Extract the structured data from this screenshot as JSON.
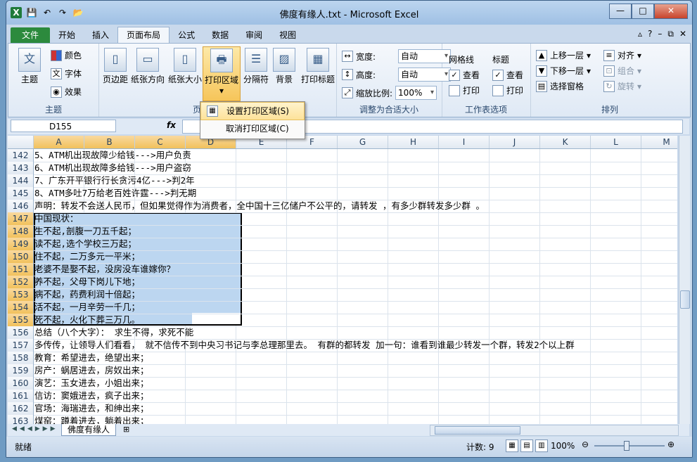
{
  "window": {
    "title": "佛度有缘人.txt - Microsoft Excel",
    "controls": {
      "minimize": "—",
      "maximize": "□",
      "close": "✕"
    }
  },
  "qat": {
    "app_icon": "X",
    "save": "💾",
    "undo": "↶",
    "redo": "↷",
    "open": "📂"
  },
  "tabs": [
    {
      "label": "文件"
    },
    {
      "label": "开始"
    },
    {
      "label": "插入"
    },
    {
      "label": "页面布局"
    },
    {
      "label": "公式"
    },
    {
      "label": "数据"
    },
    {
      "label": "审阅"
    },
    {
      "label": "视图"
    }
  ],
  "ribbon": {
    "themes": {
      "big_label": "主题",
      "colors": "颜色",
      "fonts": "字体",
      "effects": "效果",
      "group": "主题"
    },
    "page_setup": {
      "margins": "页边距",
      "orientation": "纸张方向",
      "size": "纸张大小",
      "print_area": "打印区域",
      "breaks": "分隔符",
      "background": "背景",
      "print_titles": "打印标题",
      "group": "页"
    },
    "scale": {
      "width_label": "宽度:",
      "width_value": "自动",
      "height_label": "高度:",
      "height_value": "自动",
      "scale_label": "缩放比例:",
      "scale_value": "100%",
      "group": "调整为合适大小"
    },
    "sheet_options": {
      "gridlines": "网格线",
      "headings": "标题",
      "view": "查看",
      "print": "打印",
      "group": "工作表选项"
    },
    "arrange": {
      "bring_forward": "上移一层",
      "send_backward": "下移一层",
      "selection_pane": "选择窗格",
      "align": "对齐",
      "group_btn": "组合",
      "rotate": "旋转",
      "group": "排列"
    }
  },
  "print_area_menu": [
    {
      "label": "设置打印区域(S)"
    },
    {
      "label": "取消打印区域(C)"
    }
  ],
  "formula_bar": {
    "name_box": "D155",
    "fx": "fx",
    "formula": ""
  },
  "columns": [
    "A",
    "B",
    "C",
    "D",
    "E",
    "F",
    "G",
    "H",
    "I",
    "J",
    "K",
    "L",
    "M"
  ],
  "rows": [
    {
      "n": "142",
      "text": "5、ATM机出现故障少给钱--->用户负责"
    },
    {
      "n": "143",
      "text": "6、ATM机出现故障多给钱--->用户盗窃"
    },
    {
      "n": "144",
      "text": "7、广东开平银行行长贪污4亿--->判2年"
    },
    {
      "n": "145",
      "text": "8、ATM多吐7万给老百姓许霆--->判无期"
    },
    {
      "n": "146",
      "text": "声明：转发不会送人民币，但如果觉得作为消费者，全中国十三亿储户不公平的，请转发 ，有多少群转发多少群 。"
    },
    {
      "n": "147",
      "text": "中国现状："
    },
    {
      "n": "148",
      "text": "生不起,剖腹一刀五千起；"
    },
    {
      "n": "149",
      "text": "读不起,选个学校三万起；"
    },
    {
      "n": "150",
      "text": "住不起，二万多元一平米；"
    },
    {
      "n": "151",
      "text": "老婆不是娶不起，没房没车谁嫁你？"
    },
    {
      "n": "152",
      "text": "养不起，父母下岗儿下地；"
    },
    {
      "n": "153",
      "text": "病不起，药费利润十倍起；"
    },
    {
      "n": "154",
      "text": "活不起，一月辛劳一千几；"
    },
    {
      "n": "155",
      "text": "死不起，火化下葬三万几。"
    },
    {
      "n": "156",
      "text": "总结（八个大字）： 求生不得，求死不能"
    },
    {
      "n": "157",
      "text": "多传传，让领导人们看看， 就不信传不到中央习书记与李总理那里去。 有群的都转发 加一句：谁看到谁最少转发一个群，转发2个以上群"
    },
    {
      "n": "158",
      "text": "教育：希望进去，绝望出来；"
    },
    {
      "n": "159",
      "text": "房产：蜗居进去，房奴出来；"
    },
    {
      "n": "160",
      "text": "演艺：玉女进去，小姐出来；"
    },
    {
      "n": "161",
      "text": "信访：窦娥进去，疯子出来；"
    },
    {
      "n": "162",
      "text": "官场：海瑞进去，和绅出来；"
    },
    {
      "n": "163",
      "text": "煤窑：蹲着进去，躺着出来；"
    }
  ],
  "sheet_tab": "佛度有缘人",
  "status": {
    "ready": "就绪",
    "count": "计数: 9",
    "zoom": "100%"
  }
}
